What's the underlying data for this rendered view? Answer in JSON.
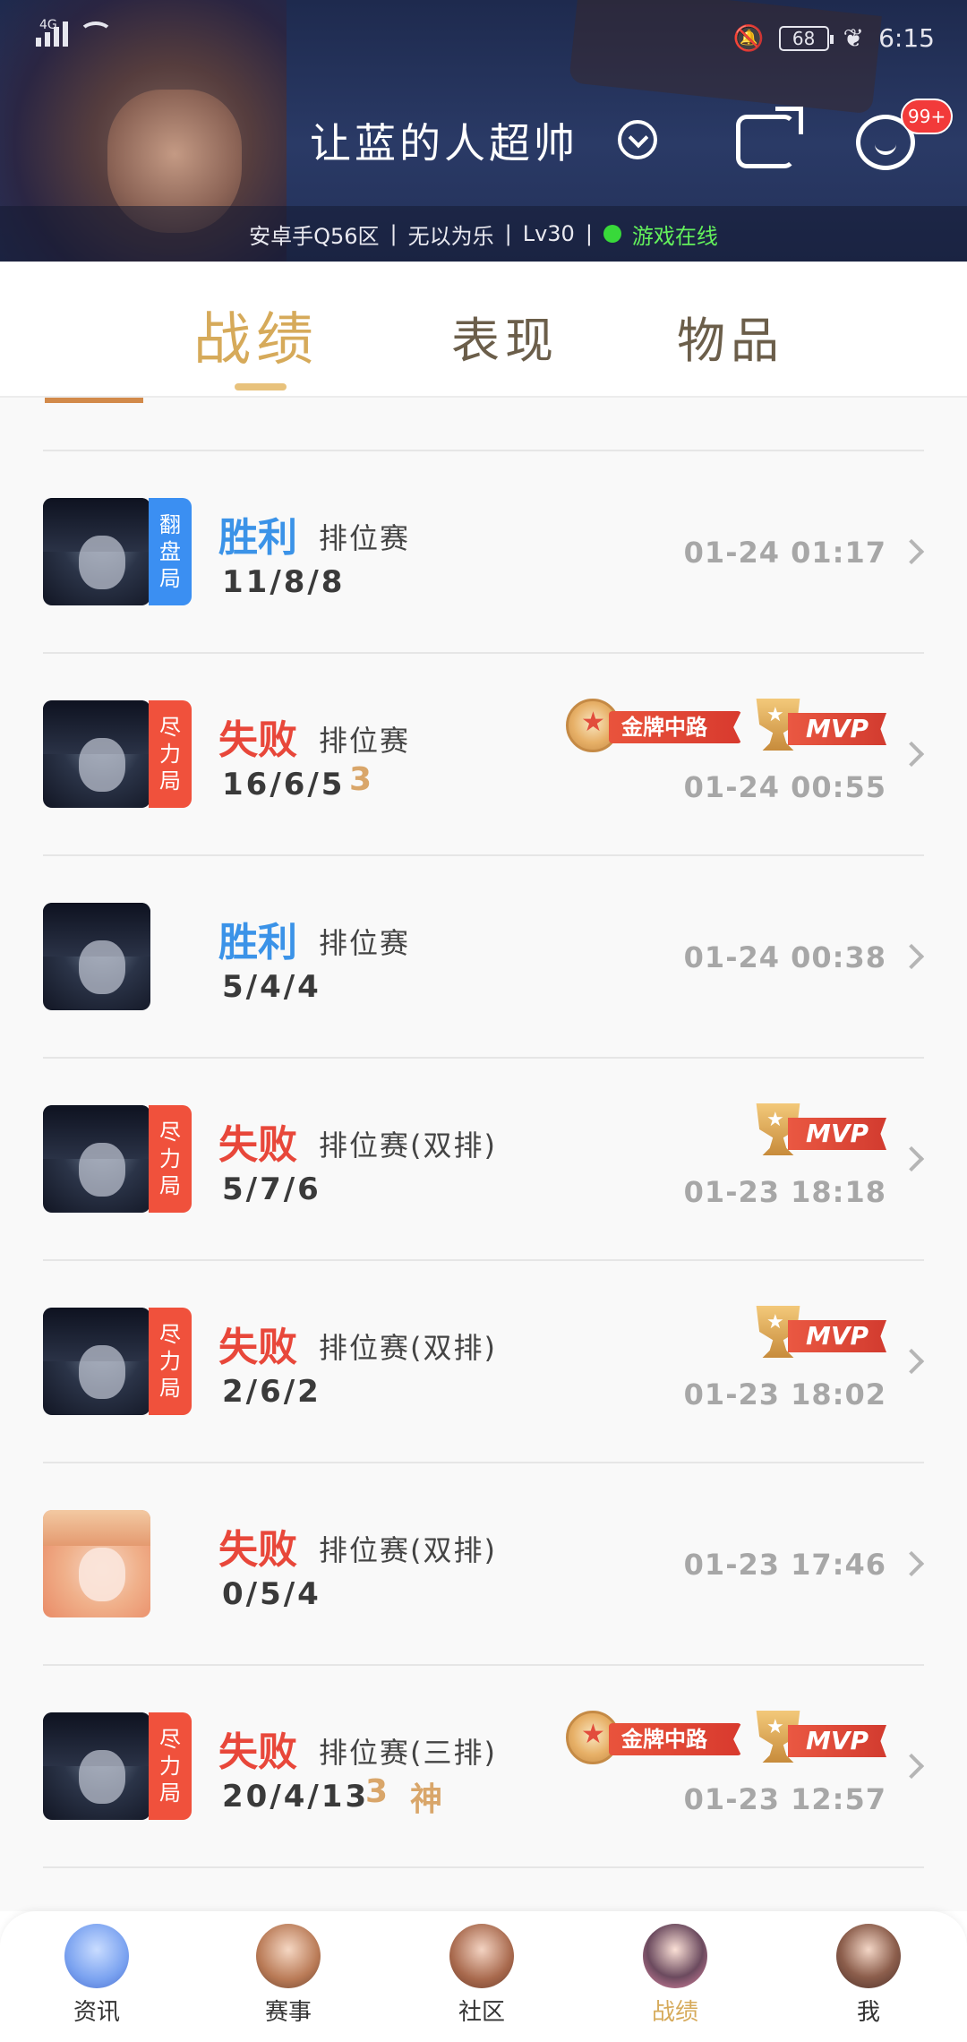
{
  "status_bar": {
    "network": "4G",
    "battery": "68",
    "time": "6:15"
  },
  "header": {
    "username": "让蓝的人超帅",
    "badge": "99+",
    "server": "安卓手Q56区",
    "separator": "|",
    "title": "无以为乐",
    "level": "Lv30",
    "status": "游戏在线"
  },
  "tabs": [
    {
      "label": "战绩"
    },
    {
      "label": "表现"
    },
    {
      "label": "物品"
    }
  ],
  "matches": [
    {
      "result": "胜利",
      "mode": "排位赛",
      "kda": "11/8/8",
      "time": "01-24 01:17",
      "tag": [
        "翻",
        "盘",
        "局"
      ],
      "extra": ""
    },
    {
      "result": "失败",
      "mode": "排位赛",
      "kda": "16/6/5",
      "time": "01-24 00:55",
      "tag": [
        "尽",
        "力",
        "局"
      ],
      "extra": "3",
      "medal": "金牌中路",
      "mvp": "MVP"
    },
    {
      "result": "胜利",
      "mode": "排位赛",
      "kda": "5/4/4",
      "time": "01-24 00:38",
      "extra": ""
    },
    {
      "result": "失败",
      "mode": "排位赛(双排)",
      "kda": "5/7/6",
      "time": "01-23 18:18",
      "tag": [
        "尽",
        "力",
        "局"
      ],
      "mvp": "MVP"
    },
    {
      "result": "失败",
      "mode": "排位赛(双排)",
      "kda": "2/6/2",
      "time": "01-23 18:02",
      "tag": [
        "尽",
        "力",
        "局"
      ],
      "mvp": "MVP"
    },
    {
      "result": "失败",
      "mode": "排位赛(双排)",
      "kda": "0/5/4",
      "time": "01-23 17:46"
    },
    {
      "result": "失败",
      "mode": "排位赛(三排)",
      "kda": "20/4/13",
      "time": "01-23 12:57",
      "tag": [
        "尽",
        "力",
        "局"
      ],
      "extra": "3",
      "extra2": "神",
      "medal": "金牌中路",
      "mvp": "MVP"
    }
  ],
  "bottom_nav": [
    {
      "label": "资讯"
    },
    {
      "label": "赛事"
    },
    {
      "label": "社区"
    },
    {
      "label": "战绩"
    },
    {
      "label": "我"
    }
  ],
  "colors": {
    "accent_gold": "#d6aa5a",
    "win_blue": "#3b93e8",
    "lose_red": "#e8473a",
    "online_green": "#38d93a"
  }
}
